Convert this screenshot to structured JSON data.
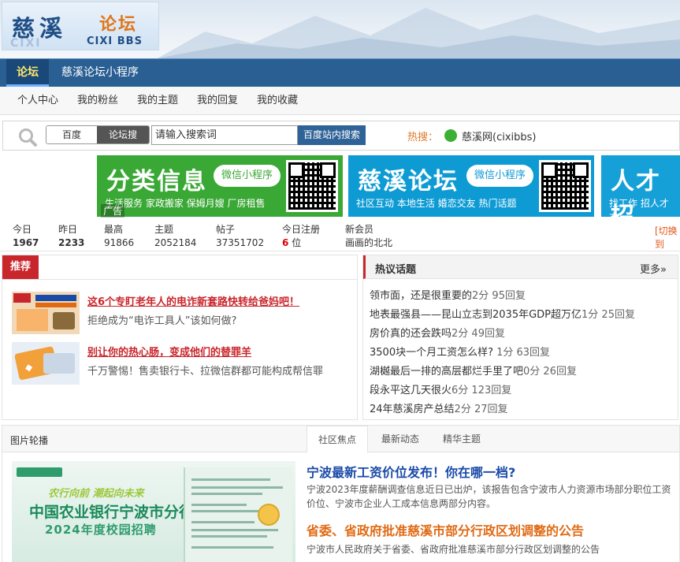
{
  "logo": {
    "cn_main": "慈溪",
    "cn_sub": "论坛",
    "en": "CIXI BBS",
    "en_shadow": "CIXI"
  },
  "nav": {
    "items": [
      "论坛",
      "慈溪论坛小程序"
    ]
  },
  "subnav": {
    "items": [
      "个人中心",
      "我的粉丝",
      "我的主题",
      "我的回复",
      "我的收藏"
    ]
  },
  "search": {
    "type_options": [
      "百度",
      "论坛搜索"
    ],
    "selected_type": "论坛搜索",
    "placeholder": "请输入搜索词",
    "button": "百度站内搜索",
    "hot_label": "热搜：",
    "hot_text": "慈溪网(cixibbs)"
  },
  "banners": [
    {
      "title": "分类信息",
      "pill": "微信小程序",
      "sub": "生活服务 家政搬家 保姆月嫂 厂房租售"
    },
    {
      "title": "慈溪论坛",
      "pill": "微信小程序",
      "sub": "社区互动 本地生活 婚恋交友 热门话题"
    },
    {
      "title": "人才招",
      "sub": "找工作 招人才 本"
    }
  ],
  "ad_tag": "广告",
  "stats": {
    "items": [
      {
        "k": "今日",
        "v": "1967",
        "style": "b"
      },
      {
        "k": "昨日",
        "v": "2233",
        "style": "b"
      },
      {
        "k": "最高",
        "v": "91866",
        "style": ""
      },
      {
        "k": "主题",
        "v": "2052184",
        "style": ""
      },
      {
        "k": "帖子",
        "v": "37351702",
        "style": ""
      },
      {
        "k": "今日注册",
        "v": "6",
        "unit": "位",
        "style": "red"
      },
      {
        "k": "新会员",
        "v": "画画的北北",
        "style": ""
      }
    ],
    "switch_link": "[切换到"
  },
  "recommend": {
    "tab": "推荐",
    "items": [
      {
        "title": "这6个专盯老年人的电诈新套路快转给爸妈吧！",
        "desc": "拒绝成为“电诈工具人”该如何做?"
      },
      {
        "title": "别让你的热心肠，变成他们的替罪羊",
        "desc": "千万警惕！售卖银行卡、拉微信群都可能构成帮信罪"
      }
    ]
  },
  "hot_topics": {
    "title": "热议话题",
    "more": "更多»",
    "items": [
      {
        "text": "领市面，还是很重要的",
        "meta": "2分 95回复"
      },
      {
        "text": "地表最强县——昆山立志到2035年GDP超万亿",
        "meta": "1分 25回复"
      },
      {
        "text": "房价真的还会跌吗",
        "meta": "2分 49回复"
      },
      {
        "text": "3500块一个月工资怎么样?",
        "meta": " 1分 63回复"
      },
      {
        "text": "湖樾最后一排的高层都烂手里了吧",
        "meta": "0分 26回复"
      },
      {
        "text": "段永平这几天很火",
        "meta": "6分 123回复"
      },
      {
        "text": "24年慈溪房产总结",
        "meta": "2分 27回复"
      }
    ]
  },
  "carousel": {
    "label": "图片轮播",
    "tabs": [
      "社区焦点",
      "最新动态",
      "精华主题"
    ],
    "active_tab": "社区焦点",
    "image_text": {
      "l1": "中国农业银行宁波市分行",
      "l2": "2024年度校园招聘",
      "l3": "农行向前 潮起向未来"
    },
    "news": [
      {
        "title": "宁波最新工资价位发布！你在哪一档?",
        "color": "blue",
        "desc": "宁波2023年度薪酬调查信息近日已出炉，该报告包含宁波市人力资源市场部分职位工资价位、宁波市企业人工成本信息两部分内容。"
      },
      {
        "title": "省委、省政府批准慈溪市部分行政区划调整的公告",
        "color": "orange",
        "desc": "宁波市人民政府关于省委、省政府批准慈溪市部分行政区划调整的公告"
      }
    ]
  },
  "colors": {
    "nav": "#2a5f93",
    "accent_red": "#c9262c",
    "banner_green": "#3aa835",
    "banner_blue": "#0e9bd4"
  }
}
